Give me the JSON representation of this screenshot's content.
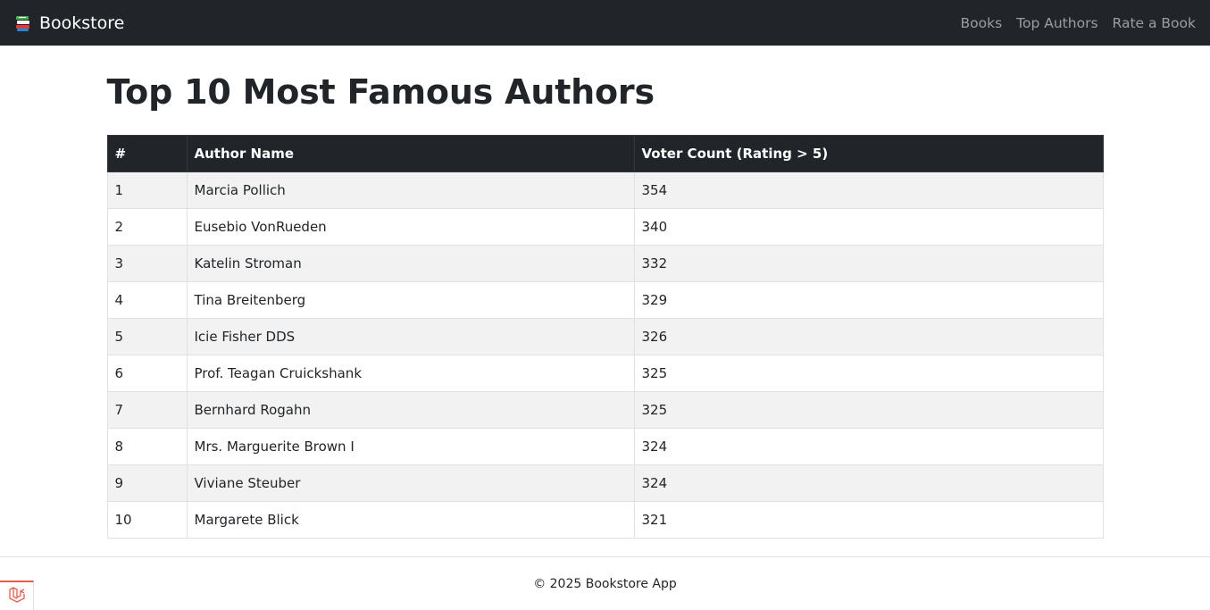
{
  "navbar": {
    "brand": "Bookstore",
    "links": [
      "Books",
      "Top Authors",
      "Rate a Book"
    ]
  },
  "page": {
    "title": "Top 10 Most Famous Authors"
  },
  "table": {
    "headers": [
      "#",
      "Author Name",
      "Voter Count (Rating > 5)"
    ],
    "rows": [
      {
        "rank": "1",
        "name": "Marcia Pollich",
        "count": "354"
      },
      {
        "rank": "2",
        "name": "Eusebio VonRueden",
        "count": "340"
      },
      {
        "rank": "3",
        "name": "Katelin Stroman",
        "count": "332"
      },
      {
        "rank": "4",
        "name": "Tina Breitenberg",
        "count": "329"
      },
      {
        "rank": "5",
        "name": "Icie Fisher DDS",
        "count": "326"
      },
      {
        "rank": "6",
        "name": "Prof. Teagan Cruickshank",
        "count": "325"
      },
      {
        "rank": "7",
        "name": "Bernhard Rogahn",
        "count": "325"
      },
      {
        "rank": "8",
        "name": "Mrs. Marguerite Brown I",
        "count": "324"
      },
      {
        "rank": "9",
        "name": "Viviane Steuber",
        "count": "324"
      },
      {
        "rank": "10",
        "name": "Margarete Blick",
        "count": "321"
      }
    ]
  },
  "footer": {
    "text": "© 2025 Bookstore App"
  },
  "colors": {
    "navbar_bg": "#212529",
    "debug_accent": "#e35d4a"
  },
  "icons": {
    "brand": "books-icon",
    "debug": "laravel-icon"
  }
}
